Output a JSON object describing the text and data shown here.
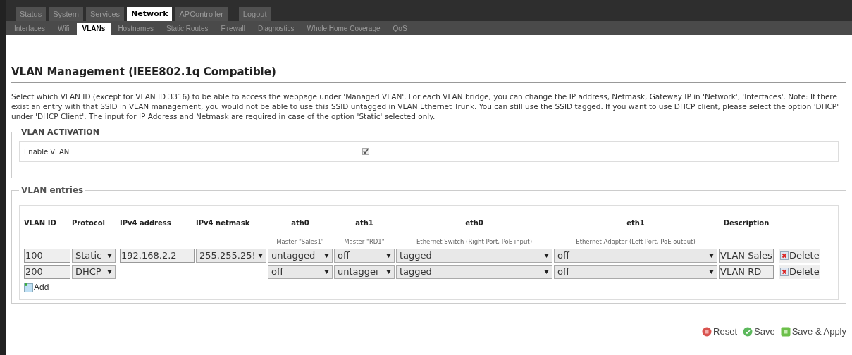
{
  "top_tabs": [
    {
      "label": "Status",
      "selected": false,
      "kind": "tab"
    },
    {
      "label": "System",
      "selected": false,
      "kind": "tab"
    },
    {
      "label": "Services",
      "selected": false,
      "kind": "tab"
    },
    {
      "label": "Network",
      "selected": true,
      "kind": "tab"
    },
    {
      "label": "APController",
      "selected": false,
      "kind": "tab"
    },
    {
      "label": "Logout",
      "selected": false,
      "kind": "action"
    }
  ],
  "sub_tabs": [
    {
      "label": "Interfaces",
      "selected": false
    },
    {
      "label": "Wifi",
      "selected": false
    },
    {
      "label": "VLANs",
      "selected": true
    },
    {
      "label": "Hostnames",
      "selected": false
    },
    {
      "label": "Static Routes",
      "selected": false
    },
    {
      "label": "Firewall",
      "selected": false
    },
    {
      "label": "Diagnostics",
      "selected": false
    },
    {
      "label": "Whole Home Coverage",
      "selected": false
    },
    {
      "label": "QoS",
      "selected": false
    }
  ],
  "title": "VLAN Management (IEEE802.1q Compatible)",
  "description": "Select which VLAN ID (except for VLAN ID 3316) to be able to access the webpage under 'Managed VLAN'. For each VLAN bridge, you can change the IP address, Netmask, Gateway IP in 'Network', 'Interfaces'. Note: If there exist an entry with that SSID in VLAN management, you would not be able to use this SSID untagged in VLAN Ethernet Trunk. You can still use the SSID tagged. If you want to use DHCP client, please select the option 'DHCP' under 'DHCP Client'. The input for IP Address and Netmask are required in case of the option 'Static' selected only.",
  "activation": {
    "legend": "VLAN ACTIVATION",
    "label": "Enable VLAN",
    "checked": true
  },
  "entries": {
    "legend": "VLAN entries",
    "columns": [
      {
        "heading": "VLAN ID"
      },
      {
        "heading": "Protocol"
      },
      {
        "heading": "IPv4 address"
      },
      {
        "heading": "IPv4 netmask"
      },
      {
        "heading": "ath0",
        "subheading": "Master \"Sales1\""
      },
      {
        "heading": "ath1",
        "subheading": "Master \"RD1\""
      },
      {
        "heading": "eth0",
        "subheading": "Ethernet Switch (Right Port, PoE input)"
      },
      {
        "heading": "eth1",
        "subheading": "Ethernet Adapter (Left Port, PoE output)"
      },
      {
        "heading": "Description"
      }
    ],
    "rows": [
      {
        "vlan_id": "100",
        "protocol": "Static",
        "ipv4_address": "192.168.2.2",
        "ipv4_netmask": "255.255.25!",
        "ath0": "untagged",
        "ath1": "off",
        "eth0": "tagged",
        "eth1": "off",
        "description": "VLAN Sales",
        "delete": "Delete"
      },
      {
        "vlan_id": "200",
        "protocol": "DHCP",
        "ath0": "off",
        "ath1": "untaggeı",
        "eth0": "tagged",
        "eth1": "off",
        "description": "VLAN RD",
        "delete": "Delete"
      }
    ],
    "add": "Add"
  },
  "buttons": [
    {
      "label": "Reset",
      "kind": "reset"
    },
    {
      "label": "Save",
      "kind": "save"
    },
    {
      "label": "Save & Apply",
      "kind": "apply"
    }
  ]
}
